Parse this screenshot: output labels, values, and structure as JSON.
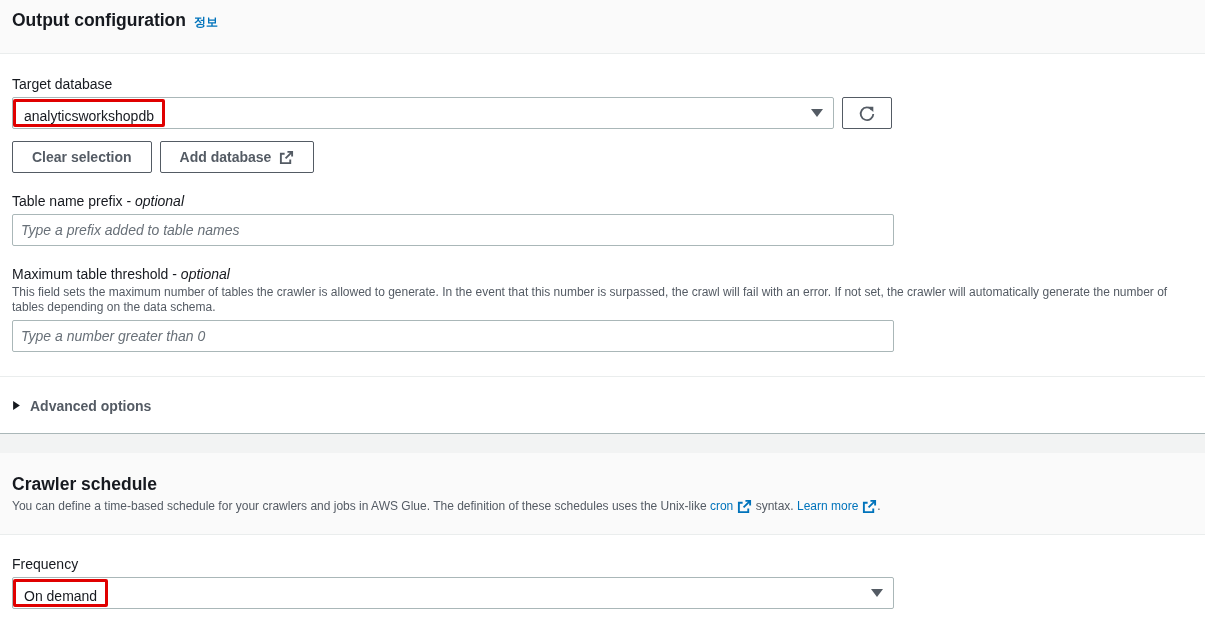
{
  "output_configuration": {
    "title": "Output configuration",
    "info_link": "정보",
    "target_database": {
      "label": "Target database",
      "value": "analyticsworkshopdb",
      "highlighted": true
    },
    "buttons": [
      "Clear selection",
      "Add database"
    ],
    "table_prefix": {
      "label": "Table name prefix - *optional*",
      "placeholder": "Type a prefix added to table names"
    },
    "max_threshold": {
      "label": "Maximum table threshold - *optional*",
      "description": "This field sets the maximum number of tables the crawler is allowed to generate. In the event that this number is surpassed, the crawl will fail with an error. If not set, the crawler will automatically generate the number of tables depending on the data schema.",
      "placeholder": "Type a number greater than 0"
    },
    "advanced_options": {
      "label": "Advanced options",
      "expanded": false
    }
  },
  "crawler_schedule": {
    "title": "Crawler schedule",
    "description": [
      {
        "kind": "text",
        "text": "You can define a time-based schedule for your crawlers and jobs in AWS Glue. The definition of these schedules uses the Unix-like "
      },
      {
        "kind": "link",
        "text": "cron"
      },
      {
        "kind": "text",
        "text": " syntax. "
      },
      {
        "kind": "link",
        "text": "Learn more"
      },
      {
        "kind": "text",
        "text": "."
      }
    ],
    "frequency": {
      "label": "Frequency",
      "value": "On demand",
      "highlighted": true
    }
  }
}
